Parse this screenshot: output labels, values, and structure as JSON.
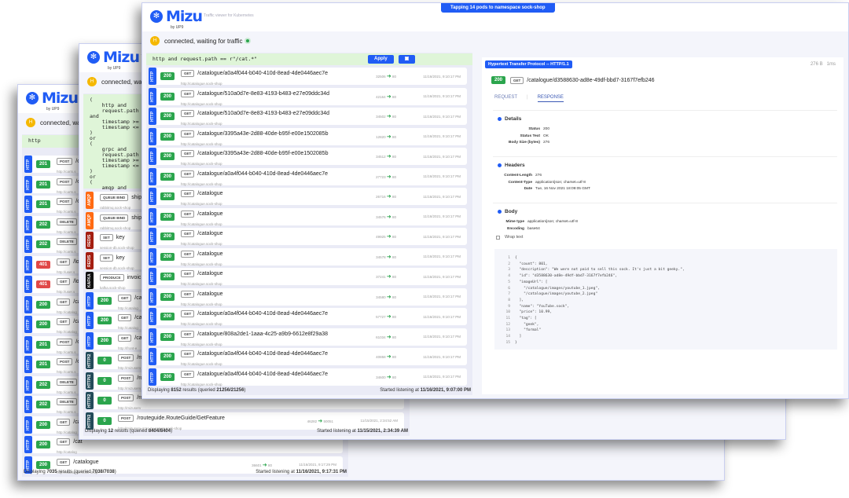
{
  "colors": {
    "accent": "#205cf5",
    "ok": "#2ba54d",
    "error": "#e04848",
    "HTTP": "#205cf5",
    "HTTP/2": "#244c5a",
    "AMQP": "#ff6a13",
    "REDIS": "#a41e11",
    "KAFKA": "#111111"
  },
  "app": {
    "logo": "Mizu",
    "by": "by UP9",
    "tagline": "Traffic viewer for Kubernetes",
    "connected": "connected, waiting for traffic",
    "avatar": "H",
    "banner": "Tapping 14 pods to namespace sock-shop",
    "apply": "Apply"
  },
  "windows": [
    {
      "filter": "http",
      "footer": {
        "pre": "Displaying ",
        "count": "7035",
        "mid": " results (queried ",
        "queried": "7038/7038",
        "post": ")",
        "listen_label": "Started listening at ",
        "listen": "11/16/2021, 9:17:31 PM"
      },
      "rows": [
        {
          "p": "HTTP",
          "s": "201",
          "m": "POST",
          "path": "/ca",
          "src": "http://carts.s",
          "sp": "",
          "dp": "",
          "t": ""
        },
        {
          "p": "HTTP",
          "s": "201",
          "m": "POST",
          "path": "/ca",
          "src": "http://carts.s",
          "sp": "",
          "dp": "",
          "t": ""
        },
        {
          "p": "HTTP",
          "s": "201",
          "m": "POST",
          "path": "/ca",
          "src": "http://carts.s",
          "sp": "",
          "dp": "",
          "t": ""
        },
        {
          "p": "HTTP",
          "s": "202",
          "m": "DELETE",
          "path": "/",
          "src": "http://carts.s",
          "sp": "",
          "dp": "",
          "t": ""
        },
        {
          "p": "HTTP",
          "s": "202",
          "m": "DELETE",
          "path": "/",
          "src": "http://carts.s",
          "sp": "",
          "dp": "",
          "t": ""
        },
        {
          "p": "HTTP",
          "s": "401",
          "m": "GET",
          "path": "/log",
          "src": "http://user.s",
          "sp": "",
          "dp": "",
          "t": ""
        },
        {
          "p": "HTTP",
          "s": "401",
          "m": "GET",
          "path": "/log",
          "src": "http://user.s",
          "sp": "",
          "dp": "",
          "t": ""
        },
        {
          "p": "HTTP",
          "s": "200",
          "m": "GET",
          "path": "/cat",
          "src": "http://catalog",
          "sp": "",
          "dp": "",
          "t": ""
        },
        {
          "p": "HTTP",
          "s": "200",
          "m": "GET",
          "path": "/cat",
          "src": "http://catalog",
          "sp": "",
          "dp": "",
          "t": ""
        },
        {
          "p": "HTTP",
          "s": "201",
          "m": "POST",
          "path": "/ca",
          "src": "http://carts.s",
          "sp": "",
          "dp": "",
          "t": ""
        },
        {
          "p": "HTTP",
          "s": "201",
          "m": "POST",
          "path": "/ca",
          "src": "http://carts.s",
          "sp": "",
          "dp": "",
          "t": ""
        },
        {
          "p": "HTTP",
          "s": "202",
          "m": "DELETE",
          "path": "/",
          "src": "http://carts.s",
          "sp": "",
          "dp": "",
          "t": ""
        },
        {
          "p": "HTTP",
          "s": "202",
          "m": "DELETE",
          "path": "/",
          "src": "http://carts.s",
          "sp": "",
          "dp": "",
          "t": ""
        },
        {
          "p": "HTTP",
          "s": "200",
          "m": "GET",
          "path": "/cat",
          "src": "http://catalog",
          "sp": "",
          "dp": "",
          "t": ""
        },
        {
          "p": "HTTP",
          "s": "200",
          "m": "GET",
          "path": "/cat",
          "src": "http://catalog",
          "sp": "",
          "dp": "",
          "t": ""
        },
        {
          "p": "HTTP",
          "s": "200",
          "m": "GET",
          "path": "/catalogue",
          "src": "http://catalogue.sock-shop",
          "sp": "36601",
          "dp": "80",
          "t": "11/16/2021, 9:17:29 PM"
        }
      ]
    },
    {
      "filter": "(\n    http and\n    request.path ==\nand\n    timestamp >= d\n    timestamp <= d\n)\nor\n(\n    grpc and\n    request.path =\n    timestamp >= d\n    timestamp <= d\n)\nor\n(\n    amqp and",
      "footer": {
        "pre": "Displaying ",
        "count": "12",
        "mid": " results (queried ",
        "queried": "8404/8404",
        "post": ")",
        "listen_label": "Started listening at ",
        "listen": "11/15/2021, 2:34:39 AM"
      },
      "rows": [
        {
          "p": "AMQP",
          "s": "",
          "m": "QUEUE BIND",
          "path": "ship",
          "src": "rabbitmq.sock-shop",
          "sp": "",
          "dp": "",
          "t": ""
        },
        {
          "p": "AMQP",
          "s": "",
          "m": "QUEUE BIND",
          "path": "ship",
          "src": "rabbitmq.sock-shop",
          "sp": "",
          "dp": "",
          "t": ""
        },
        {
          "p": "REDIS",
          "s": "",
          "m": "SET",
          "path": "key",
          "src": "session-db.sock-shop",
          "sp": "",
          "dp": "",
          "t": ""
        },
        {
          "p": "REDIS",
          "s": "",
          "m": "SET",
          "path": "key",
          "src": "session-db.sock-shop",
          "sp": "",
          "dp": "",
          "t": ""
        },
        {
          "p": "KAFKA",
          "s": "",
          "m": "PRODUCE",
          "path": "invoic",
          "src": "kafka.sock-shop",
          "sp": "",
          "dp": "",
          "t": ""
        },
        {
          "p": "HTTP",
          "s": "200",
          "m": "GET",
          "path": "/ca",
          "src": "http://catalog",
          "sp": "",
          "dp": "",
          "t": ""
        },
        {
          "p": "HTTP",
          "s": "200",
          "m": "GET",
          "path": "/ca",
          "src": "http://catalog",
          "sp": "",
          "dp": "",
          "t": ""
        },
        {
          "p": "HTTP",
          "s": "200",
          "m": "GET",
          "path": "/ca",
          "src": "http://front-e",
          "sp": "",
          "dp": "",
          "t": ""
        },
        {
          "p": "HTTP/2",
          "s": "0",
          "m": "POST",
          "path": "/ro",
          "src": "http://mizuserv",
          "sp": "",
          "dp": "",
          "t": ""
        },
        {
          "p": "HTTP/2",
          "s": "0",
          "m": "POST",
          "path": "/ro",
          "src": "http://mizuserv",
          "sp": "",
          "dp": "",
          "t": ""
        },
        {
          "p": "HTTP/2",
          "s": "0",
          "m": "POST",
          "path": "/ro",
          "src": "http://mizuserv",
          "sp": "",
          "dp": "",
          "t": ""
        },
        {
          "p": "HTTP/2",
          "s": "0",
          "m": "POST",
          "path": "/routeguide.RouteGuide/GetFeature",
          "src": "http://mizuserv-grpc-py-server.sock-shop",
          "sp": "46282",
          "dp": "50051",
          "t": "11/15/2021, 2:34:52 AM"
        }
      ]
    },
    {
      "filter": "http and request.path == r\"/cat.*\"",
      "footer": {
        "pre": "Displaying ",
        "count": "8152",
        "mid": " results (queried ",
        "queried": "21256/21256",
        "post": ")",
        "listen_label": "Started listening at ",
        "listen": "11/16/2021, 9:07:00 PM"
      },
      "rows": [
        {
          "p": "HTTP",
          "s": "200",
          "m": "GET",
          "path": "/catalogue/a0a4f044-b040-410d-8ead-4de0446aec7e",
          "src": "http://catalogue.sock-shop",
          "sp": "32506",
          "dp": "80",
          "t": "11/16/2021, 9:10:17 PM"
        },
        {
          "p": "HTTP",
          "s": "200",
          "m": "GET",
          "path": "/catalogue/510a0d7e-8e83-4193-b483-e27e09ddc34d",
          "src": "http://catalogue.sock-shop",
          "sp": "42164",
          "dp": "80",
          "t": "11/16/2021, 9:10:17 PM"
        },
        {
          "p": "HTTP",
          "s": "200",
          "m": "GET",
          "path": "/catalogue/510a0d7e-8e83-4193-b483-e27e09ddc34d",
          "src": "http://catalogue.sock-shop",
          "sp": "34502",
          "dp": "80",
          "t": "11/16/2021, 9:10:17 PM"
        },
        {
          "p": "HTTP",
          "s": "200",
          "m": "GET",
          "path": "/catalogue/3395a43e-2d88-40de-b95f-e00e1502085b",
          "src": "http://catalogue.sock-shop",
          "sp": "12820",
          "dp": "80",
          "t": "11/16/2021, 9:10:17 PM"
        },
        {
          "p": "HTTP",
          "s": "200",
          "m": "GET",
          "path": "/catalogue/3395a43e-2d88-40de-b95f-e00e1502085b",
          "src": "http://catalogue.sock-shop",
          "sp": "34512",
          "dp": "80",
          "t": "11/16/2021, 9:10:17 PM"
        },
        {
          "p": "HTTP",
          "s": "200",
          "m": "GET",
          "path": "/catalogue/a0a4f044-b040-410d-8ead-4de0446aec7e",
          "src": "http://catalogue.sock-shop",
          "sp": "27723",
          "dp": "80",
          "t": "11/16/2021, 9:10:17 PM"
        },
        {
          "p": "HTTP",
          "s": "200",
          "m": "GET",
          "path": "/catalogue",
          "src": "http://catalogue.sock-shop",
          "sp": "26716",
          "dp": "80",
          "t": "11/16/2021, 9:10:17 PM"
        },
        {
          "p": "HTTP",
          "s": "200",
          "m": "GET",
          "path": "/catalogue",
          "src": "http://catalogue.sock-shop",
          "sp": "34576",
          "dp": "80",
          "t": "11/16/2021, 9:10:17 PM"
        },
        {
          "p": "HTTP",
          "s": "200",
          "m": "GET",
          "path": "/catalogue",
          "src": "http://catalogue.sock-shop",
          "sp": "49925",
          "dp": "80",
          "t": "11/16/2021, 9:10:17 PM"
        },
        {
          "p": "HTTP",
          "s": "200",
          "m": "GET",
          "path": "/catalogue",
          "src": "http://catalogue.sock-shop",
          "sp": "34578",
          "dp": "80",
          "t": "11/16/2021, 9:10:17 PM"
        },
        {
          "p": "HTTP",
          "s": "200",
          "m": "GET",
          "path": "/catalogue",
          "src": "http://catalogue.sock-shop",
          "sp": "37241",
          "dp": "80",
          "t": "11/16/2021, 9:10:17 PM"
        },
        {
          "p": "HTTP",
          "s": "200",
          "m": "GET",
          "path": "/catalogue",
          "src": "http://catalogue.sock-shop",
          "sp": "34580",
          "dp": "80",
          "t": "11/16/2021, 9:10:17 PM"
        },
        {
          "p": "HTTP",
          "s": "200",
          "m": "GET",
          "path": "/catalogue/a0a4f044-b040-410d-8ead-4de0446aec7e",
          "src": "http://catalogue.sock-shop",
          "sp": "57727",
          "dp": "80",
          "t": "11/16/2021, 9:10:17 PM"
        },
        {
          "p": "HTTP",
          "s": "200",
          "m": "GET",
          "path": "/catalogue/808a2de1-1aaa-4c25-a9b9-6612e8f29a38",
          "src": "http://catalogue.sock-shop",
          "sp": "61034",
          "dp": "80",
          "t": "11/16/2021, 9:10:17 PM"
        },
        {
          "p": "HTTP",
          "s": "200",
          "m": "GET",
          "path": "/catalogue/a0a4f044-b040-410d-8ead-4de0446aec7e",
          "src": "http://catalogue.sock-shop",
          "sp": "40858",
          "dp": "80",
          "t": "11/16/2021, 9:10:17 PM"
        },
        {
          "p": "HTTP",
          "s": "200",
          "m": "GET",
          "path": "/catalogue/a0a4f044-b040-410d-8ead-4de0446aec7e",
          "src": "http://catalogue.sock-shop",
          "sp": "34600",
          "dp": "80",
          "t": "11/16/2021, 9:10:17 PM"
        }
      ]
    }
  ],
  "detail": {
    "protocol": "Hypertext Transfer Protocol -- HTTP/1.1",
    "size": "276 B",
    "elapsed": "1ms",
    "status": "200",
    "method": "GET",
    "path": "/catalogue/d3588630-ad8e-49df-bbd7-3167f7efb246",
    "tabs": {
      "request": "REQUEST",
      "response": "RESPONSE"
    },
    "details": {
      "title": "Details",
      "items": [
        {
          "k": "Status",
          "v": "200"
        },
        {
          "k": "Status Text",
          "v": "OK"
        },
        {
          "k": "Body Size (bytes)",
          "v": "276"
        }
      ]
    },
    "headers": {
      "title": "Headers",
      "items": [
        {
          "k": "Content-Length",
          "v": "276"
        },
        {
          "k": "Content-Type",
          "v": "application/json; charset=utf-8"
        },
        {
          "k": "Date",
          "v": "Tue, 16 Nov 2021 18:09:05 GMT"
        }
      ]
    },
    "body": {
      "title": "Body",
      "items": [
        {
          "k": "Mime type",
          "v": "application/json; charset=utf-8"
        },
        {
          "k": "Encoding",
          "v": "base64"
        }
      ],
      "wrap": "Wrap text",
      "lines": [
        "{",
        "  \"count\": 801,",
        "  \"description\": \"We were not paid to sell this sock. It's just a bit geeky.\",",
        "  \"id\": \"d3588630-ad8e-49df-bbd7-3167f7efb246\",",
        "  \"imageUrl\": [",
        "    \"/catalogue/images/youtube_1.jpeg\",",
        "    \"/catalogue/images/youtube_2.jpeg\"",
        "  ],",
        "  \"name\": \"YouTube.sock\",",
        "  \"price\": 10.99,",
        "  \"tag\": [",
        "    \"geek\",",
        "    \"formal\"",
        "  ]",
        "}"
      ]
    }
  }
}
